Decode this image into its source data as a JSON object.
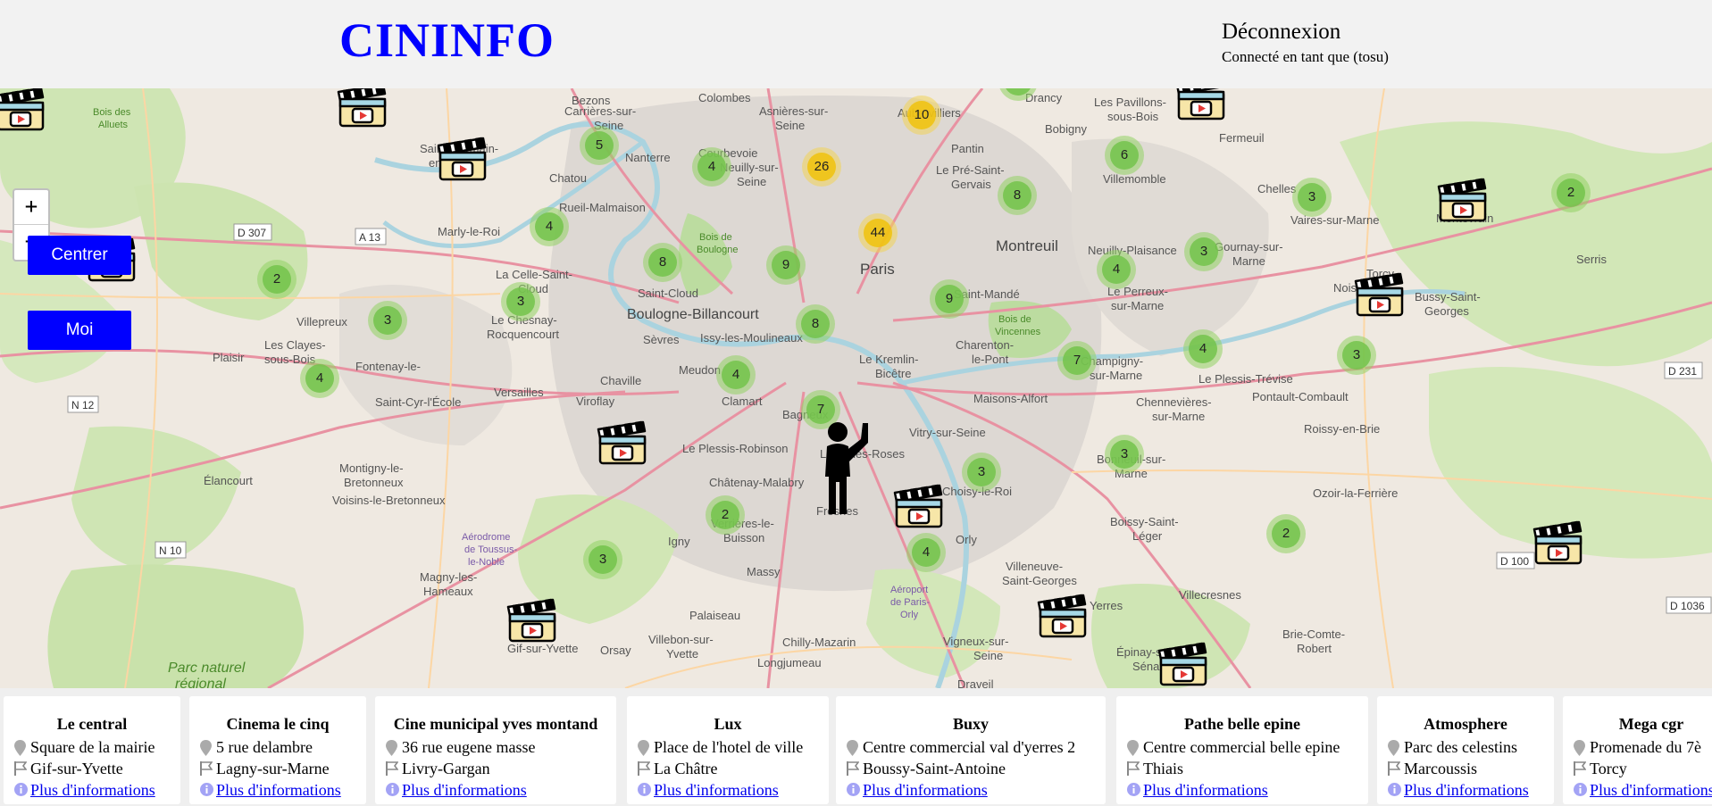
{
  "header": {
    "logo": "CININFO",
    "logout_label": "Déconnexion",
    "connected_label": "Connecté en tant que (tosu)"
  },
  "map": {
    "zoom_in": "+",
    "zoom_out": "−",
    "center_button": "Centrer",
    "me_button": "Moi",
    "place_labels": [
      "Bezons",
      "Colombes",
      "Aubervilliers",
      "Drancy",
      "Les Pavillons-sous-Bois",
      "Carrières-sur-Seine",
      "Asnières-sur-Seine",
      "Bobigny",
      "Fermeuil",
      "Chatou",
      "Nanterre",
      "Courbevoie",
      "Neuilly-sur-Seine",
      "Pantin",
      "Le Pré-Saint-Gervais",
      "Villemomble",
      "Chelles",
      "Rueil-Malmaison",
      "Marly-le-Roi",
      "Bois de Boulogne",
      "Paris",
      "Montreuil",
      "Neuilly-Plaisance",
      "Gournay-sur-Marne",
      "Vaires-sur-Marne",
      "Montévrain",
      "Serris",
      "Saint-Cloud",
      "Saint-Mandé",
      "Noisiel",
      "Torcy",
      "La Celle-Saint-Cloud",
      "Le Chesnay-Rocquencourt",
      "Boulogne-Billancourt",
      "Issy-les-Moulineaux",
      "Charenton-le-Pont",
      "Le Perreux-sur-Marne",
      "Bussy-Saint-Georges",
      "Villepreux",
      "Plaisir",
      "Les Clayes-sous-Bois",
      "Fontenay-le-Fleury",
      "Versailles",
      "Sèvres",
      "Meudon",
      "Chaville",
      "Viroflay",
      "Le Kremlin-Bicêtre",
      "Champigny-sur-Marne",
      "Le Plessis-Trévise",
      "Pontault-Combault",
      "Saint-Cyr-l'École",
      "Clamart",
      "Bagneux",
      "Maisons-Alfort",
      "Chennevières-sur-Marne",
      "Vitry-sur-Seine",
      "Le Plessis-Robinson",
      "L'Haÿ-les-Roses",
      "Élancourt",
      "Montigny-le-Bretonneux",
      "Voisins-le-Bretonneux",
      "Châtenay-Malabry",
      "Fresnes",
      "Choisy-le-Roi",
      "Bonneuil-sur-Marne",
      "Roissy-en-Brie",
      "Ozoir-la-Ferrière",
      "Verrières-le-Buisson",
      "Igny",
      "Orly",
      "Boissy-Saint-Léger",
      "Aérodrome de Toussus-le-Noble",
      "Massy",
      "Villeneuve-Saint-Georges",
      "Magny-les-Hameaux",
      "Aéroport de Paris-Orly",
      "Yerres",
      "Villecresnes",
      "Palaiseau",
      "Chilly-Mazarin",
      "Brie-Comte-Robert",
      "Villebon-sur-Yvette",
      "Orsay",
      "Longjumeau",
      "Vigneux-sur-Seine",
      "Épinay-sous-Sénart",
      "Draveil",
      "Gif-sur-Yvette",
      "Parc naturel régional",
      "Bois de Vincennes",
      "Bois des Alluets",
      "Saint-Germain-en-Laye"
    ],
    "road_labels": [
      "D 307",
      "A 13",
      "N 12",
      "N 10",
      "D 231",
      "D 100",
      "D 1036"
    ],
    "clusters": [
      {
        "count": "3",
        "level": "green"
      },
      {
        "count": "10",
        "level": "yellow"
      },
      {
        "count": "5",
        "level": "green"
      },
      {
        "count": "4",
        "level": "green"
      },
      {
        "count": "26",
        "level": "yellow"
      },
      {
        "count": "6",
        "level": "green"
      },
      {
        "count": "8",
        "level": "green"
      },
      {
        "count": "3",
        "level": "green"
      },
      {
        "count": "2",
        "level": "green"
      },
      {
        "count": "4",
        "level": "green"
      },
      {
        "count": "44",
        "level": "yellow"
      },
      {
        "count": "3",
        "level": "green"
      },
      {
        "count": "8",
        "level": "green"
      },
      {
        "count": "9",
        "level": "green"
      },
      {
        "count": "4",
        "level": "green"
      },
      {
        "count": "2",
        "level": "green"
      },
      {
        "count": "3",
        "level": "green"
      },
      {
        "count": "9",
        "level": "green"
      },
      {
        "count": "3",
        "level": "green"
      },
      {
        "count": "8",
        "level": "green"
      },
      {
        "count": "7",
        "level": "green"
      },
      {
        "count": "4",
        "level": "green"
      },
      {
        "count": "3",
        "level": "green"
      },
      {
        "count": "4",
        "level": "green"
      },
      {
        "count": "4",
        "level": "green"
      },
      {
        "count": "7",
        "level": "green"
      },
      {
        "count": "3",
        "level": "green"
      },
      {
        "count": "3",
        "level": "green"
      },
      {
        "count": "2",
        "level": "green"
      },
      {
        "count": "2",
        "level": "green"
      },
      {
        "count": "4",
        "level": "green"
      },
      {
        "count": "3",
        "level": "green"
      }
    ],
    "colors": {
      "cluster_green": "#73c34b",
      "cluster_yellow": "#f0c20c",
      "button": "#0000ff"
    }
  },
  "cinemas": [
    {
      "name": "Le central",
      "address": "Square de la mairie",
      "city": "Gif-sur-Yvette",
      "more": " Plus d'informations"
    },
    {
      "name": "Cinema le cinq",
      "address": "5 rue delambre",
      "city": "Lagny-sur-Marne",
      "more": " Plus d'informations"
    },
    {
      "name": "Cine municipal yves montand",
      "address": "36 rue eugene masse",
      "city": "Livry-Gargan",
      "more": " Plus d'informations"
    },
    {
      "name": "Lux",
      "address": "Place de l'hotel de ville",
      "city": "La Châtre",
      "more": " Plus d'informations"
    },
    {
      "name": "Buxy",
      "address": "Centre commercial val d'yerres 2",
      "city": "Boussy-Saint-Antoine",
      "more": " Plus d'informations"
    },
    {
      "name": "Pathe belle epine",
      "address": "Centre commercial belle epine",
      "city": "Thiais",
      "more": " Plus d'informations"
    },
    {
      "name": "Atmosphere",
      "address": "Parc des celestins",
      "city": "Marcoussis",
      "more": " Plus d'informations"
    },
    {
      "name": "Mega cgr",
      "address": "Promenade du 7è",
      "city": "Torcy",
      "more": " Plus d'informations"
    }
  ]
}
